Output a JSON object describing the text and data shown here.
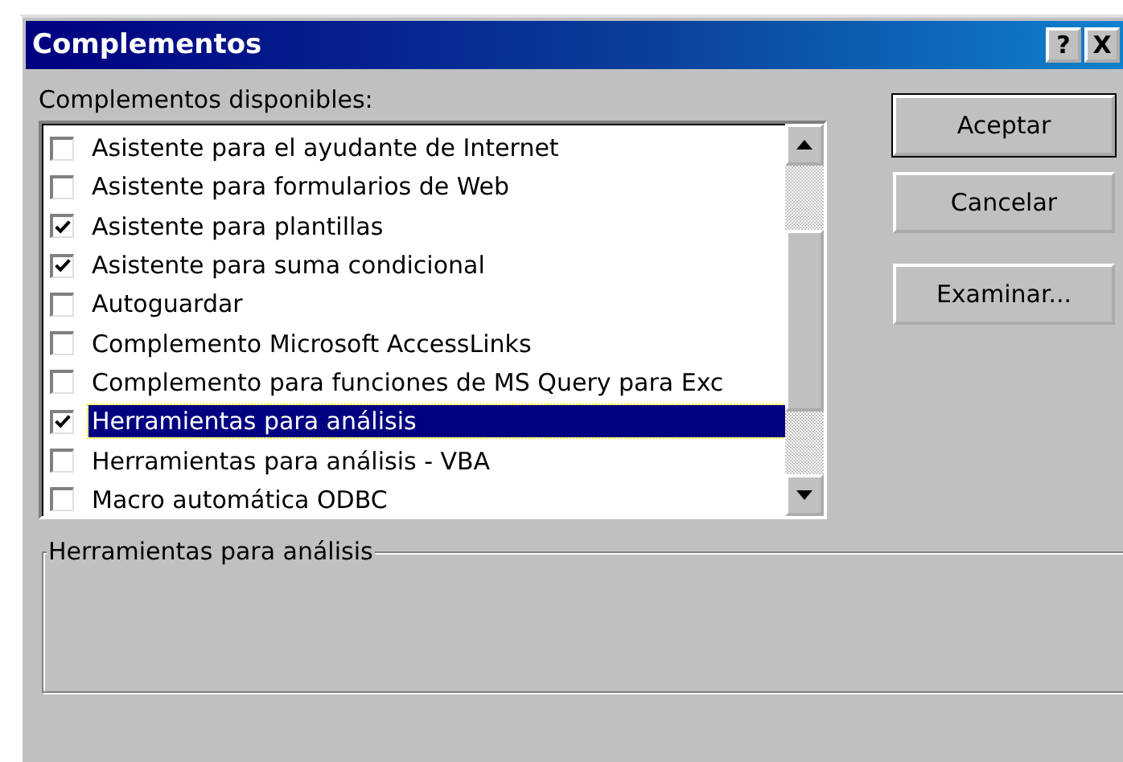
{
  "window": {
    "title": "Complementos",
    "title_buttons": [
      {
        "label": "?"
      },
      {
        "label": "X"
      }
    ]
  },
  "list_label": {
    "text": "Complementos disponibles:"
  },
  "addins": [
    {
      "label": "Asistente para el ayudante de Internet",
      "checked": false,
      "selected": false
    },
    {
      "label": "Asistente para formularios de Web",
      "checked": false,
      "selected": false
    },
    {
      "label": "Asistente para plantillas",
      "checked": true,
      "selected": false
    },
    {
      "label": "Asistente para suma condicional",
      "checked": true,
      "selected": false
    },
    {
      "label": "Autoguardar",
      "checked": false,
      "selected": false
    },
    {
      "label": "Complemento Microsoft AccessLinks",
      "checked": false,
      "selected": false
    },
    {
      "label": "Complemento para funciones de MS Query para Exc",
      "checked": false,
      "selected": false
    },
    {
      "label": "Herramientas para análisis",
      "checked": true,
      "selected": true
    },
    {
      "label": "Herramientas para análisis - VBA",
      "checked": false,
      "selected": false
    },
    {
      "label": "Macro automática ODBC",
      "checked": false,
      "selected": false
    }
  ],
  "buttons": [
    {
      "label": "Aceptar",
      "default": true
    },
    {
      "label": "Cancelar",
      "default": false
    },
    {
      "label": "Examinar...",
      "default": false
    }
  ],
  "description": {
    "title": "Herramientas para análisis"
  }
}
